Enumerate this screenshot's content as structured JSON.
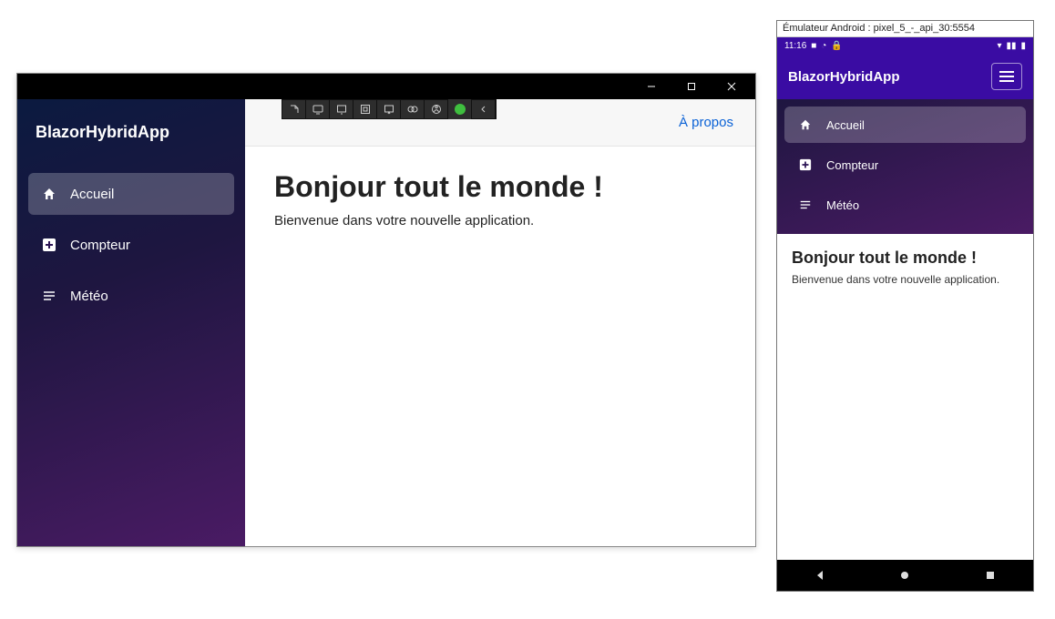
{
  "desktop": {
    "appTitle": "BlazorHybridApp",
    "nav": [
      {
        "label": "Accueil",
        "icon": "home"
      },
      {
        "label": "Compteur",
        "icon": "plus"
      },
      {
        "label": "Météo",
        "icon": "list"
      }
    ],
    "aboutLabel": "À propos",
    "heading": "Bonjour tout le monde !",
    "subheading": "Bienvenue dans votre nouvelle application."
  },
  "emulator": {
    "windowTitle": "Émulateur Android : pixel_5_-_api_30:5554",
    "statusTime": "11:16",
    "appTitle": "BlazorHybridApp",
    "nav": [
      {
        "label": "Accueil",
        "icon": "home"
      },
      {
        "label": "Compteur",
        "icon": "plus"
      },
      {
        "label": "Météo",
        "icon": "list"
      }
    ],
    "heading": "Bonjour tout le monde !",
    "subheading": "Bienvenue dans votre nouvelle application."
  }
}
